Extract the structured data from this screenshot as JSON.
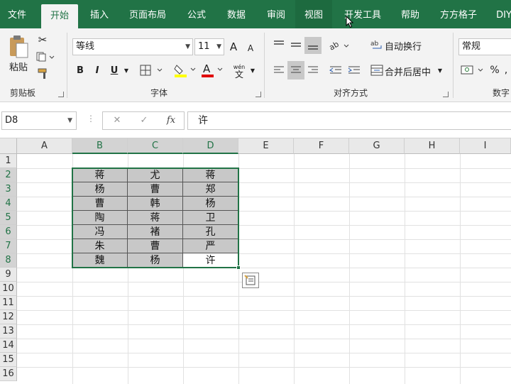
{
  "tabs": [
    {
      "label": "文件"
    },
    {
      "label": "开始"
    },
    {
      "label": "插入"
    },
    {
      "label": "页面布局"
    },
    {
      "label": "公式"
    },
    {
      "label": "数据"
    },
    {
      "label": "审阅"
    },
    {
      "label": "视图"
    },
    {
      "label": "开发工具"
    },
    {
      "label": "帮助"
    },
    {
      "label": "方方格子"
    },
    {
      "label": "DIY"
    }
  ],
  "active_tab": "开始",
  "ribbon": {
    "clipboard": {
      "paste_label": "粘贴",
      "group_label": "剪贴板"
    },
    "font": {
      "font_name": "等线",
      "font_size": "11",
      "bold": "B",
      "italic": "I",
      "underline": "U",
      "grow": "A",
      "shrink": "A",
      "phonetic": "wén",
      "phonetic_char": "文",
      "group_label": "字体"
    },
    "alignment": {
      "wrap_label": "自动换行",
      "merge_label": "合并后居中",
      "group_label": "对齐方式"
    },
    "number": {
      "format": "常规",
      "percent": "%",
      "group_label": "数字"
    }
  },
  "formula_bar": {
    "name_box": "D8",
    "cancel": "✕",
    "enter": "✓",
    "fx": "fx",
    "content": "许"
  },
  "columns": [
    "A",
    "B",
    "C",
    "D",
    "E",
    "F",
    "G",
    "H",
    "I"
  ],
  "rows": [
    "1",
    "2",
    "3",
    "4",
    "5",
    "6",
    "7",
    "8",
    "9",
    "10",
    "11",
    "12",
    "13",
    "14",
    "15",
    "16"
  ],
  "table": [
    [
      "蒋",
      "尤",
      "蒋"
    ],
    [
      "杨",
      "曹",
      "郑"
    ],
    [
      "曹",
      "韩",
      "杨"
    ],
    [
      "陶",
      "蒋",
      "卫"
    ],
    [
      "冯",
      "褚",
      "孔"
    ],
    [
      "朱",
      "曹",
      "严"
    ],
    [
      "魏",
      "杨",
      "许"
    ]
  ],
  "colors": {
    "accent": "#217346",
    "selection_fill": "#c8c8c8"
  }
}
